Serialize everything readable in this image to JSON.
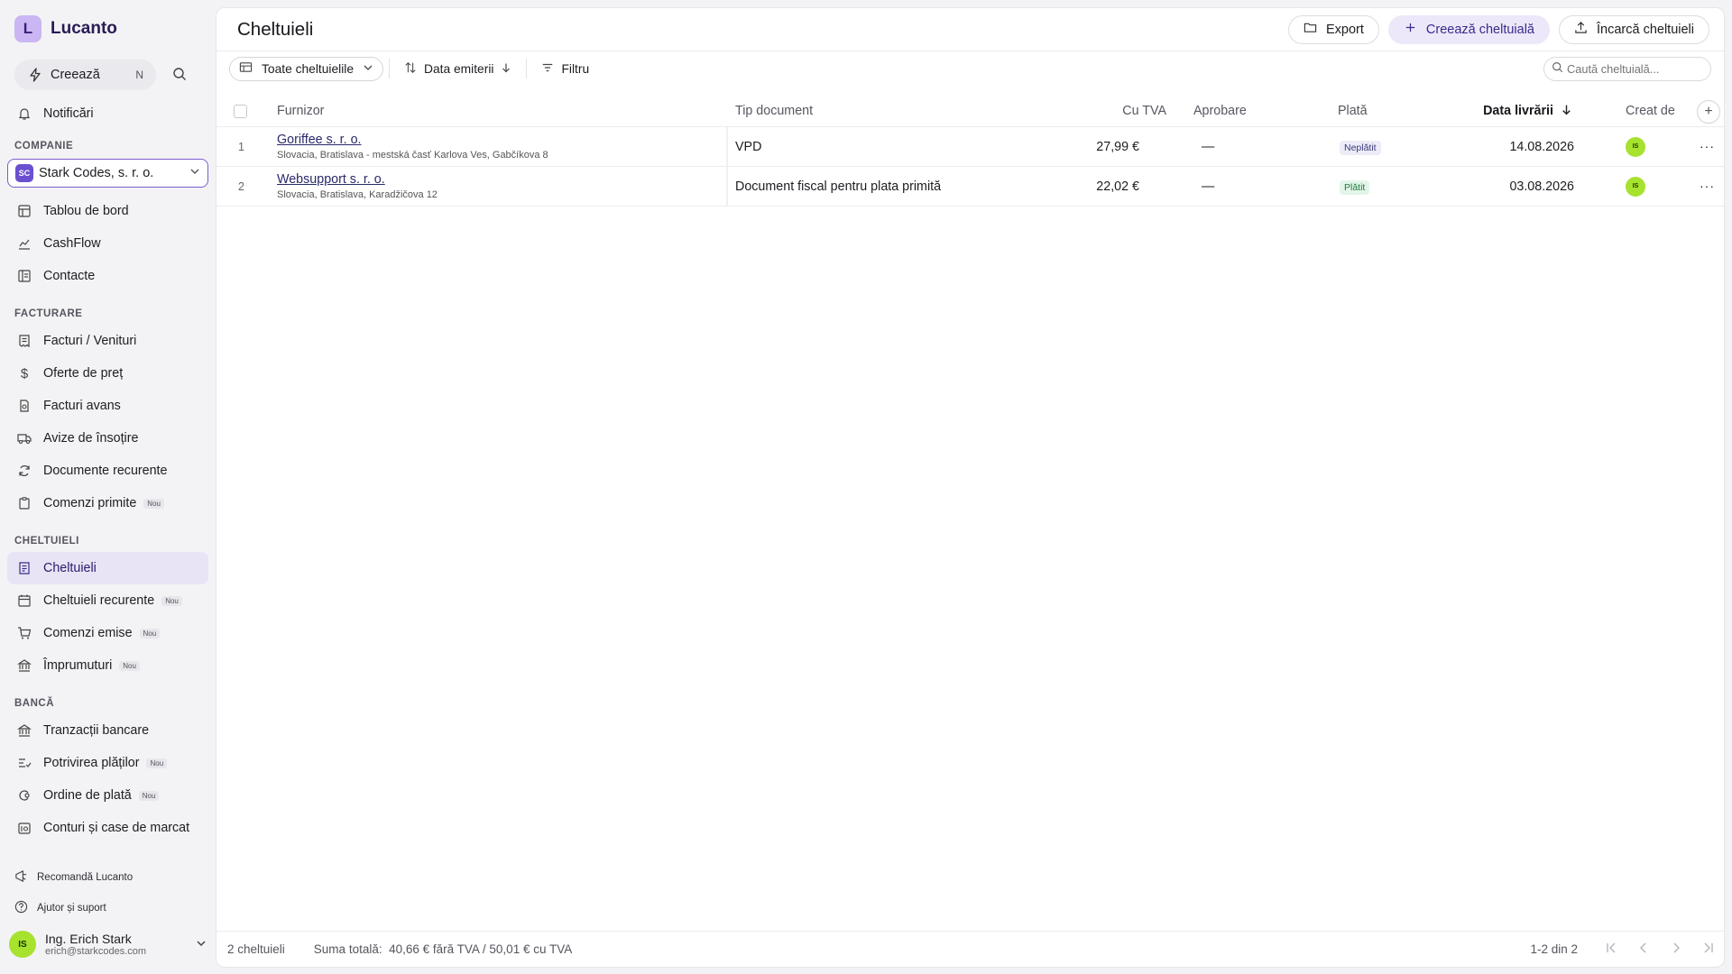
{
  "brand": {
    "logo_letter": "L",
    "name": "Lucanto"
  },
  "sidebar": {
    "create_label": "Creează",
    "create_shortcut": "N",
    "notifications": "Notificări",
    "company_section": "COMPANIE",
    "company": {
      "initials": "SC",
      "name": "Stark Codes, s. r. o."
    },
    "company_items": [
      {
        "label": "Tablou de bord",
        "icon": "dashboard-icon"
      },
      {
        "label": "CashFlow",
        "icon": "chart-icon"
      },
      {
        "label": "Contacte",
        "icon": "contacts-icon"
      }
    ],
    "billing_section": "FACTURARE",
    "billing_items": [
      {
        "label": "Facturi / Venituri",
        "icon": "invoice-icon"
      },
      {
        "label": "Oferte de preț",
        "icon": "dollar-icon"
      },
      {
        "label": "Facturi avans",
        "icon": "advance-invoice-icon"
      },
      {
        "label": "Avize de însoțire",
        "icon": "truck-icon"
      },
      {
        "label": "Documente recurente",
        "icon": "recurring-icon"
      },
      {
        "label": "Comenzi primite",
        "icon": "clipboard-icon",
        "badge": "Nou"
      }
    ],
    "expenses_section": "CHELTUIELI",
    "expense_items": [
      {
        "label": "Cheltuieli",
        "icon": "receipt-icon",
        "active": true
      },
      {
        "label": "Cheltuieli recurente",
        "icon": "calendar-recurring-icon",
        "badge": "Nou"
      },
      {
        "label": "Comenzi emise",
        "icon": "cart-icon",
        "badge": "Nou"
      },
      {
        "label": "Împrumuturi",
        "icon": "bank-icon",
        "badge": "Nou"
      }
    ],
    "bank_section": "BANCĂ",
    "bank_items": [
      {
        "label": "Tranzacții bancare",
        "icon": "bank-icon"
      },
      {
        "label": "Potrivirea plăților",
        "icon": "match-icon",
        "badge": "Nou"
      },
      {
        "label": "Ordine de plată",
        "icon": "payment-order-icon",
        "badge": "Nou"
      },
      {
        "label": "Conturi și case de marcat",
        "icon": "cash-register-icon"
      }
    ],
    "recommend": "Recomandă Lucanto",
    "help": "Ajutor și suport",
    "user": {
      "initials": "IS",
      "name": "Ing. Erich Stark",
      "email": "erich@starkcodes.com"
    }
  },
  "header": {
    "title": "Cheltuieli",
    "export_label": "Export",
    "create_label": "Creează cheltuială",
    "upload_label": "Încarcă cheltuieli"
  },
  "toolbar": {
    "view_label": "Toate cheltuielile",
    "sort_label": "Data emiterii",
    "filter_label": "Filtru",
    "search_placeholder": "Caută cheltuială..."
  },
  "table": {
    "columns": {
      "supplier": "Furnizor",
      "doc_type": "Tip document",
      "with_vat": "Cu TVA",
      "approval": "Aprobare",
      "payment": "Plată",
      "delivery_date": "Data livrării",
      "created_by": "Creat de"
    },
    "rows": [
      {
        "num": "1",
        "supplier": "Goriffee s. r. o.",
        "address": "Slovacia, Bratislava - mestská časť Karlova Ves, Gabčíkova 8",
        "doc_type": "VPD",
        "with_vat": "27,99 €",
        "approval": "—",
        "payment": "Neplătit",
        "payment_status": "unpaid",
        "delivery_date": "14.08.2026",
        "created_by": "IS"
      },
      {
        "num": "2",
        "supplier": "Websupport s. r. o.",
        "address": "Slovacia, Bratislava, Karadžičova 12",
        "doc_type": "Document fiscal pentru plata primită",
        "with_vat": "22,02 €",
        "approval": "—",
        "payment": "Plătit",
        "payment_status": "paid",
        "delivery_date": "03.08.2026",
        "created_by": "IS"
      }
    ]
  },
  "footer": {
    "count": "2 cheltuieli",
    "total": "Suma totală:  40,66 € fără TVA / 50,01 € cu TVA",
    "range": "1-2 din 2"
  },
  "colors": {
    "accent": "#7b5cd1",
    "paid": "#1e7a3f",
    "avatar": "#a6e22e"
  }
}
